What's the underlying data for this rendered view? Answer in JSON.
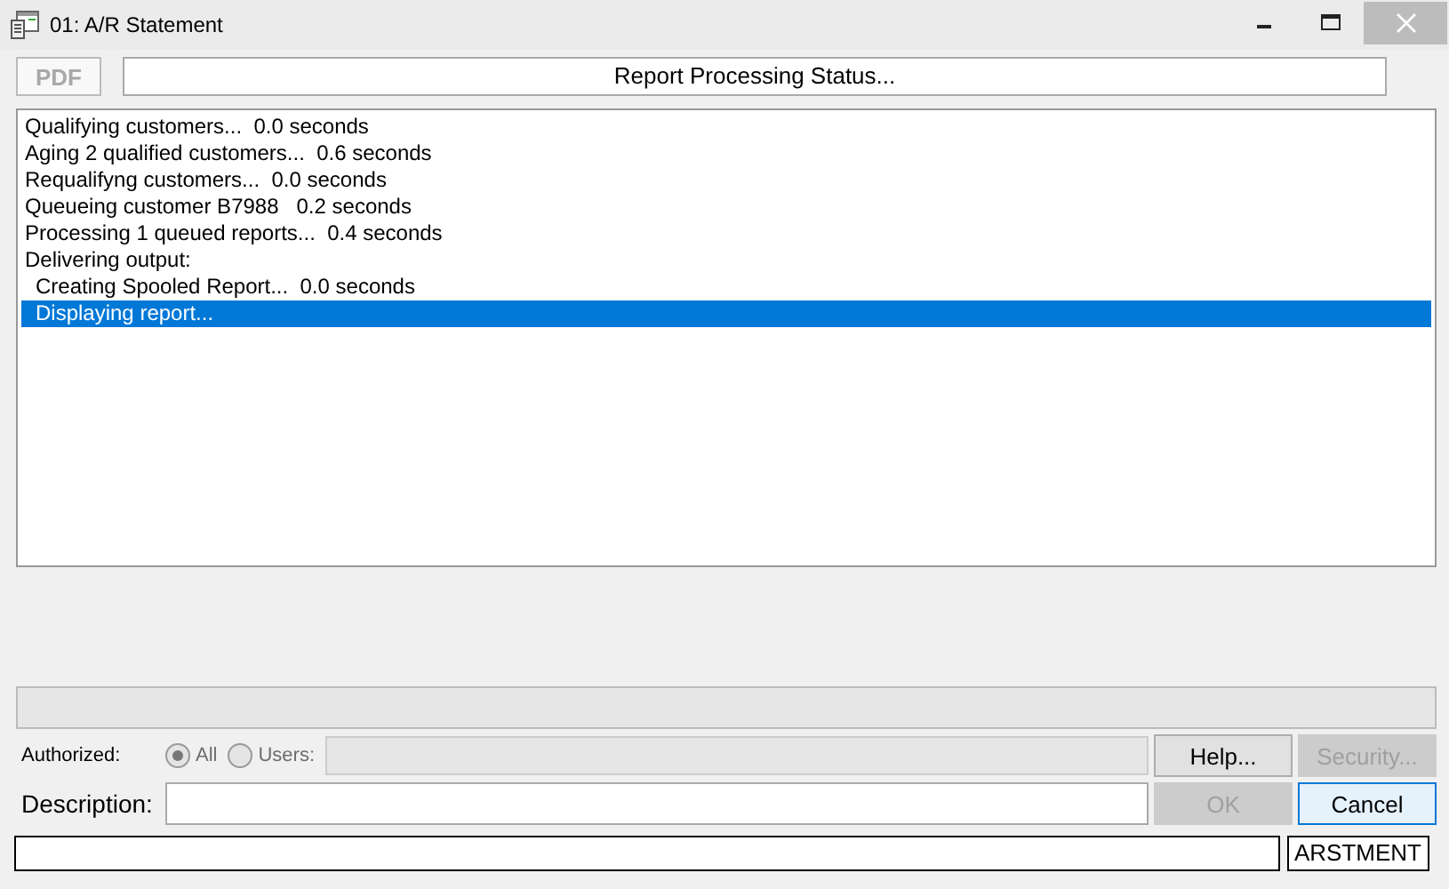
{
  "window": {
    "title": "01:  A/R Statement",
    "close_disabled": true
  },
  "toolbar": {
    "pdf_button": {
      "label": "PDF",
      "disabled": true
    },
    "status_title": "Report Processing Status..."
  },
  "log": [
    {
      "text": "Qualifying customers...  0.0 seconds",
      "selected": false
    },
    {
      "text": "Aging 2 qualified customers...  0.6 seconds",
      "selected": false
    },
    {
      "text": "Requalifyng customers...  0.0 seconds",
      "selected": false
    },
    {
      "text": "Queueing customer B7988   0.2 seconds",
      "selected": false
    },
    {
      "text": "Processing 1 queued reports...  0.4 seconds",
      "selected": false
    },
    {
      "text": "Delivering output:",
      "selected": false,
      "children": [
        {
          "text": "Creating Spooled Report...  0.0 seconds",
          "selected": false
        },
        {
          "text": "Displaying report...",
          "selected": true
        }
      ]
    }
  ],
  "progress": {
    "level": 0
  },
  "authorized": {
    "label": "Authorized:",
    "options": [
      {
        "label": "All",
        "selected": true
      },
      {
        "label": "Users:",
        "selected": false
      }
    ],
    "users_field": {
      "disabled": true
    }
  },
  "buttons_top": [
    {
      "label": "Help...",
      "disabled": false
    },
    {
      "label": "Security...",
      "disabled": true
    }
  ],
  "description": {
    "label": "Description:"
  },
  "buttons_bottom": [
    {
      "label": "OK",
      "disabled": true,
      "focused": false
    },
    {
      "label": "Cancel",
      "disabled": false,
      "focused": true
    }
  ],
  "status_bar": {
    "right": "ARSTMENT"
  }
}
